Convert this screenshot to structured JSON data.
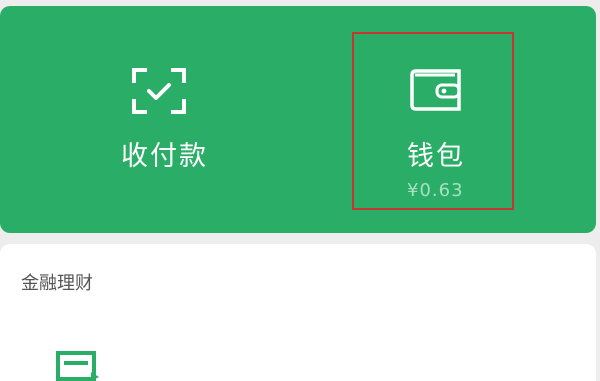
{
  "pay_panel": {
    "collect_label": "收付款",
    "wallet_label": "钱包",
    "wallet_balance": "¥0.63",
    "collect_icon": "scan-payment-icon",
    "wallet_icon": "wallet-icon"
  },
  "finance_section": {
    "title": "金融理财",
    "first_icon": "finance-card-icon"
  },
  "colors": {
    "primary_green": "#2aae67",
    "balance_green": "#a9dfc1",
    "highlight_red": "#c8342f",
    "background": "#ededed"
  }
}
